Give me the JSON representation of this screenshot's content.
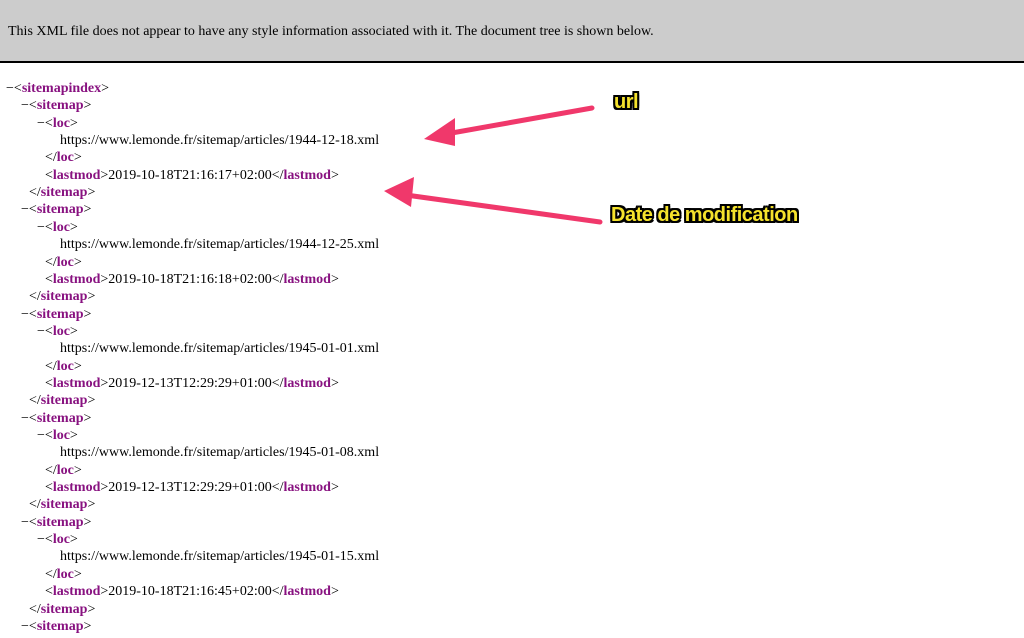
{
  "info_bar": {
    "message": "This XML file does not appear to have any style information associated with it. The document tree is shown below."
  },
  "tree": {
    "toggle": "−",
    "root_tag": "sitemapindex",
    "item_tag": "sitemap",
    "loc_tag": "loc",
    "lastmod_tag": "lastmod",
    "sitemaps": [
      {
        "loc": "https://www.lemonde.fr/sitemap/articles/1944-12-18.xml",
        "lastmod": "2019-10-18T21:16:17+02:00"
      },
      {
        "loc": "https://www.lemonde.fr/sitemap/articles/1944-12-25.xml",
        "lastmod": "2019-10-18T21:16:18+02:00"
      },
      {
        "loc": "https://www.lemonde.fr/sitemap/articles/1945-01-01.xml",
        "lastmod": "2019-12-13T12:29:29+01:00"
      },
      {
        "loc": "https://www.lemonde.fr/sitemap/articles/1945-01-08.xml",
        "lastmod": "2019-12-13T12:29:29+01:00"
      },
      {
        "loc": "https://www.lemonde.fr/sitemap/articles/1945-01-15.xml",
        "lastmod": "2019-10-18T21:16:45+02:00"
      }
    ]
  },
  "annotations": {
    "url_label": "url",
    "date_label": "Date de modification",
    "arrow_color": "#f0386b",
    "label_color": "#f5e22c"
  },
  "colors": {
    "tag": "#881280",
    "info_bg": "#cccccc"
  }
}
